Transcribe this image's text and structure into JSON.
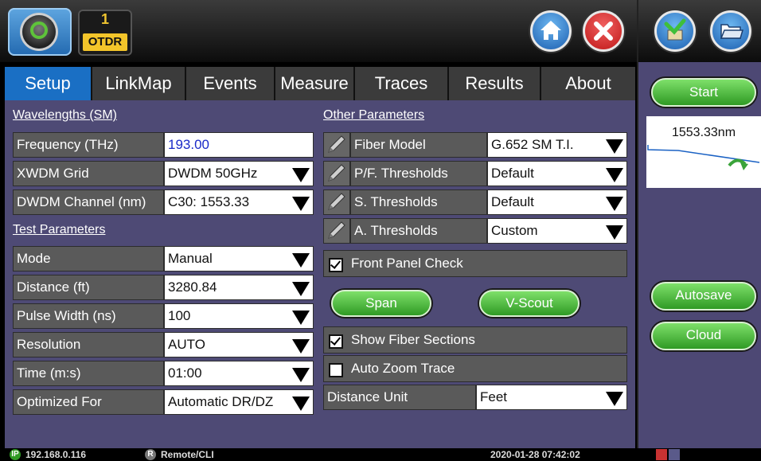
{
  "header": {
    "otdr_number": "1",
    "otdr_label": "OTDR"
  },
  "tabs": [
    {
      "label": "Setup",
      "active": true
    },
    {
      "label": "LinkMap",
      "active": false
    },
    {
      "label": "Events",
      "active": false
    },
    {
      "label": "Measure",
      "active": false
    },
    {
      "label": "Traces",
      "active": false
    },
    {
      "label": "Results",
      "active": false
    },
    {
      "label": "About",
      "active": false
    }
  ],
  "wavelengths": {
    "title": "Wavelengths (SM)",
    "frequency": {
      "label": "Frequency (THz)",
      "value": "193.00"
    },
    "grid": {
      "label": "XWDM Grid",
      "value": "DWDM 50GHz"
    },
    "channel": {
      "label": "DWDM Channel (nm)",
      "value": "C30: 1553.33"
    }
  },
  "test_params": {
    "title": "Test Parameters",
    "mode": {
      "label": "Mode",
      "value": "Manual"
    },
    "distance": {
      "label": "Distance (ft)",
      "value": "3280.84"
    },
    "pulse": {
      "label": "Pulse Width (ns)",
      "value": "100"
    },
    "resolution": {
      "label": "Resolution",
      "value": "AUTO"
    },
    "time": {
      "label": "Time (m:s)",
      "value": "01:00"
    },
    "optimized": {
      "label": "Optimized For",
      "value": "Automatic DR/DZ"
    }
  },
  "other_params": {
    "title": "Other Parameters",
    "fiber_model": {
      "label": "Fiber Model",
      "value": "G.652 SM T.I."
    },
    "pf_thresholds": {
      "label": "P/F. Thresholds",
      "value": "Default"
    },
    "s_thresholds": {
      "label": "S. Thresholds",
      "value": "Default"
    },
    "a_thresholds": {
      "label": "A. Thresholds",
      "value": "Custom"
    },
    "front_panel_check": {
      "label": "Front Panel Check",
      "checked": true
    },
    "span_label": "Span",
    "vscout_label": "V-Scout",
    "show_fiber_sections": {
      "label": "Show Fiber Sections",
      "checked": true
    },
    "auto_zoom": {
      "label": "Auto Zoom Trace",
      "checked": false
    },
    "distance_unit": {
      "label": "Distance Unit",
      "value": "Feet"
    }
  },
  "sidebar": {
    "start_label": "Start",
    "preview_wavelength": "1553.33nm",
    "autosave_label": "Autosave",
    "cloud_label": "Cloud"
  },
  "status": {
    "ip_badge": "IP",
    "ip": "192.168.0.116",
    "remote_badge": "R",
    "remote": "Remote/CLI",
    "datetime": "2020-01-28 07:42:02"
  },
  "colors": {
    "accent_tab": "#1a6fc4",
    "panel": "#4e4a75",
    "green_button": "#2f9a24"
  }
}
